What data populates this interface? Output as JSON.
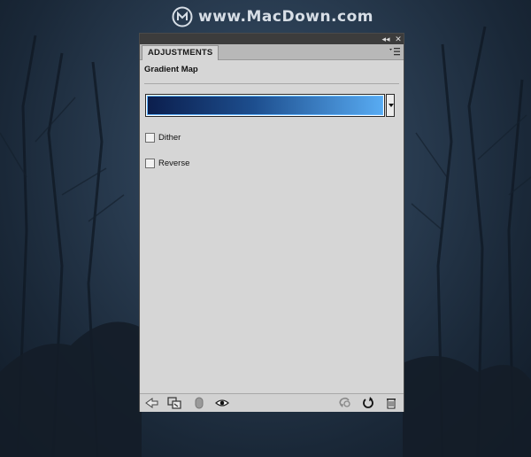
{
  "watermark": {
    "text": "www.MacDown.com"
  },
  "panel": {
    "tab_label": "ADJUSTMENTS",
    "title": "Gradient Map",
    "gradient": {
      "start_color": "#0b1e4d",
      "mid_color": "#1d4e8e",
      "end_color": "#58abf2"
    },
    "options": [
      {
        "label": "Dither",
        "checked": false
      },
      {
        "label": "Reverse",
        "checked": false
      }
    ]
  },
  "icons": {
    "titlebar": [
      "collapse-icon",
      "close-icon"
    ],
    "bottom_left": [
      "back-arrow-icon",
      "clip-layer-icon",
      "mask-icon",
      "visibility-eye-icon"
    ],
    "bottom_right": [
      "previous-state-icon",
      "reset-icon",
      "delete-icon"
    ]
  }
}
